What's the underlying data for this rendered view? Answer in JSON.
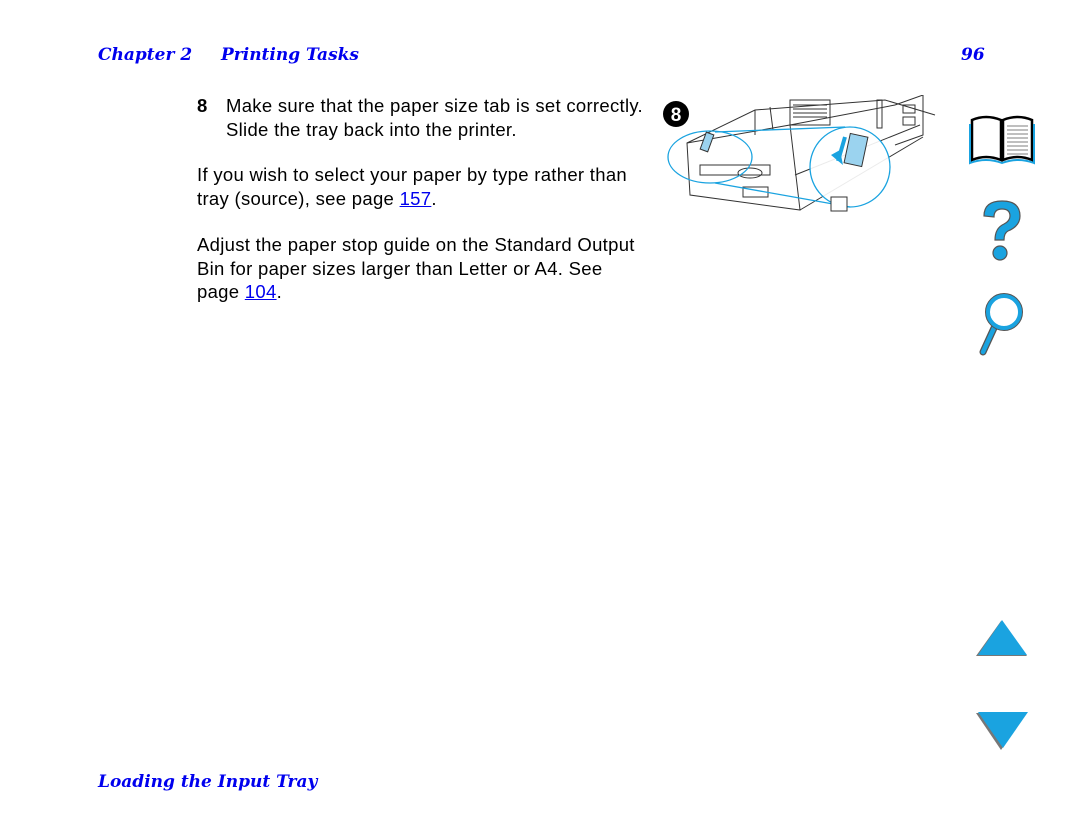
{
  "header": {
    "chapter_label": "Chapter 2",
    "chapter_title": "Printing Tasks",
    "page_number": "96"
  },
  "content": {
    "step": {
      "number": "8",
      "text": "Make sure that the paper size tab is set correctly. Slide the tray back into the printer."
    },
    "paragraph1": {
      "text_before": "If you wish to select your paper by type rather than tray (source), see page ",
      "link": "157",
      "text_after": "."
    },
    "paragraph2": {
      "text_before": "Adjust the paper stop guide on the Standard Output Bin for paper sizes larger than Letter or A4. See page ",
      "link": "104",
      "text_after": "."
    },
    "illustration": {
      "step_badge": "8",
      "description": "paper tray with paper size tab, magnified detail"
    }
  },
  "footer": {
    "section_title": "Loading the Input Tray"
  },
  "nav": {
    "contents": "book-icon",
    "help": "question-icon",
    "search": "magnifier-icon",
    "prev": "up-arrow-icon",
    "next": "down-arrow-icon",
    "accent_color": "#1aa3e0"
  }
}
